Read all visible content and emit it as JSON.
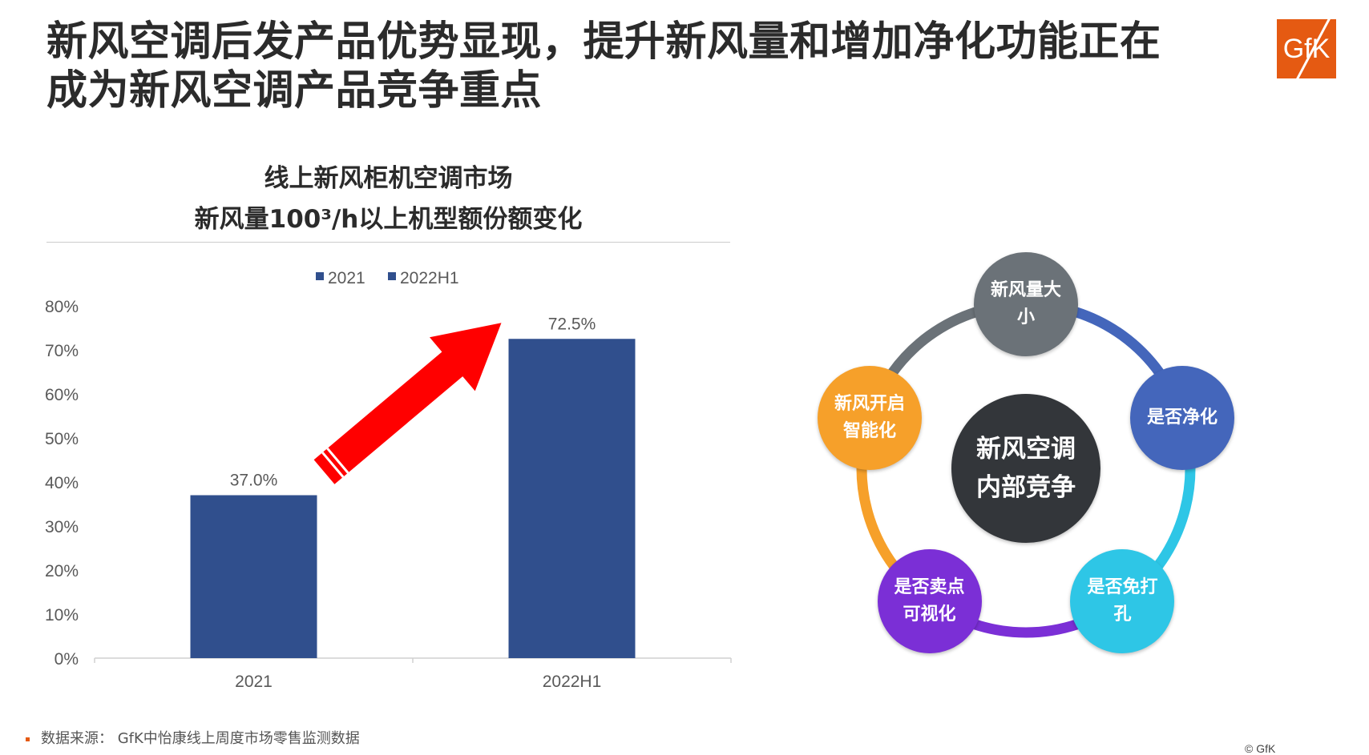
{
  "slide": {
    "title_line1": "新风空调后发产品优势显现，提升新风量和增加净化功能正在",
    "title_line2": "成为新风空调产品竞争重点",
    "logo": "GfK",
    "source": "数据来源： GfK中怡康线上周度市场零售监测数据",
    "copyright": "© GfK"
  },
  "chart_data": {
    "type": "bar",
    "title_line1": "线上新风柜机空调市场",
    "title_line2": "新风量100³/h以上机型额份额变化",
    "categories": [
      "2021",
      "2022H1"
    ],
    "values": [
      37.0,
      72.5
    ],
    "value_labels": [
      "37.0%",
      "72.5%"
    ],
    "legend": [
      "2021",
      "2022H1"
    ],
    "legend_position": "top",
    "ylim": [
      0,
      80
    ],
    "yticks": [
      "0%",
      "10%",
      "20%",
      "30%",
      "40%",
      "50%",
      "60%",
      "70%",
      "80%"
    ],
    "grid": false,
    "colors": {
      "bar": "#304f8d",
      "arrow": "#ff0000"
    },
    "annotation": "red arrow rising from 2021 bar to 2022H1 bar"
  },
  "diagram": {
    "center": {
      "line1": "新风空调",
      "line2": "内部竞争",
      "color": "#33363a"
    },
    "nodes": [
      {
        "line1": "新风量大",
        "line2": "小",
        "color": "#6b7278"
      },
      {
        "line1": "是否净化",
        "line2": "",
        "color": "#4466bb"
      },
      {
        "line1": "是否免打",
        "line2": "孔",
        "color": "#2ec6e6"
      },
      {
        "line1": "是否卖点",
        "line2": "可视化",
        "color": "#7b2fd6"
      },
      {
        "line1": "新风开启",
        "line2": "智能化",
        "color": "#f6a02a"
      }
    ]
  }
}
